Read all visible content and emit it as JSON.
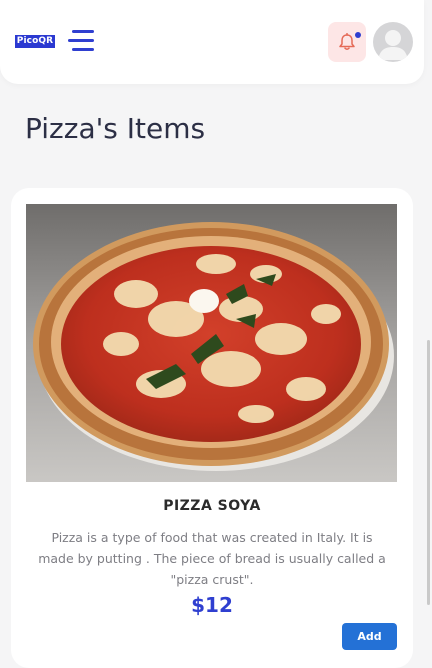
{
  "header": {
    "logo_text": "PicoQR",
    "menu_icon": "hamburger-menu-icon",
    "notification_icon": "bell-icon",
    "avatar_icon": "user-avatar-icon",
    "colors": {
      "brand": "#2f3fd0",
      "bell_bg": "#fde6e6",
      "bell_stroke": "#e56a57"
    }
  },
  "page": {
    "title": "Pizza's Items"
  },
  "item": {
    "name": "PIZZA SOYA",
    "description": "Pizza is a type of food that was created in Italy. It is made by putting . The piece of bread is usually called a \"pizza crust\".",
    "price": "$12",
    "add_label": "Add",
    "image": "pizza-photo"
  }
}
